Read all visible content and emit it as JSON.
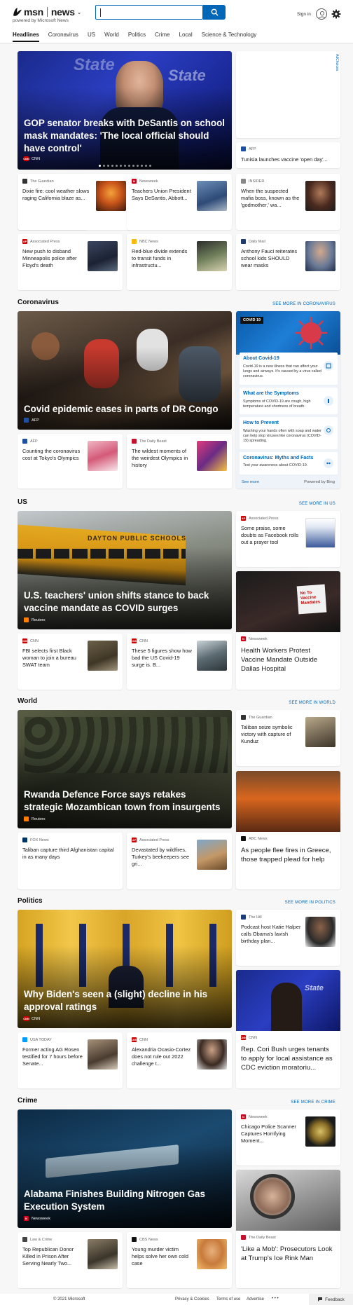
{
  "header": {
    "logo_msn": "msn",
    "logo_news": "news",
    "powered": "powered by Microsoft News",
    "search_value": "",
    "signin": "Sign in",
    "nav": [
      "Headlines",
      "Coronavirus",
      "US",
      "World",
      "Politics",
      "Crime",
      "Local",
      "Science & Technology"
    ]
  },
  "ad": {
    "label": "AdChoices"
  },
  "headlines": {
    "hero": {
      "title": "GOP senator breaks with DeSantis on school mask mandates: 'The local official should have control'",
      "source": "CNN",
      "slide_count": 13,
      "active_slide": 1
    },
    "side": {
      "source": "AFP",
      "title": "Tunisia launches vaccine 'open day'..."
    },
    "cards": [
      {
        "source": "The Guardian",
        "title": "Dixie fire: cool weather slows raging California blaze as..."
      },
      {
        "source": "Newsweek",
        "title": "Teachers Union President Says DeSantis, Abbott..."
      },
      {
        "source": "INSIDER",
        "title": "When the suspected mafia boss, known as the 'godmother,' wa..."
      },
      {
        "source": "Associated Press",
        "title": "New push to disband Minneapolis police after Floyd's death"
      },
      {
        "source": "NBC News",
        "title": "Red-blue divide extends to transit funds in infrastructu..."
      },
      {
        "source": "Daily Mail",
        "title": "Anthony Fauci reiterates school kids SHOULD wear masks"
      }
    ]
  },
  "coronavirus": {
    "heading": "Coronavirus",
    "see_more": "SEE MORE IN CORONAVIRUS",
    "hero": {
      "title": "Covid epidemic eases in parts of DR Congo",
      "source": "AFP"
    },
    "cards": [
      {
        "source": "AFP",
        "title": "Counting the coronavirus cost at Tokyo's Olympics"
      },
      {
        "source": "The Daily Beast",
        "title": "The wildest moments of the weirdest Olympics in history"
      }
    ],
    "info": {
      "badge": "COVID 19",
      "items": [
        {
          "title": "About Covid-19",
          "desc": "Covid-19 is a new illness that can affect your lungs and airways. It's caused by a virus called coronavirus."
        },
        {
          "title": "What are the Symptoms",
          "desc": "Symptoms of COVID-19 are cough, high temperature and shortness of breath."
        },
        {
          "title": "How to Prevent",
          "desc": "Washing your hands often with soap and water can help stop viruses like coronavirus (COVID-19) spreading."
        },
        {
          "title": "Coronavirus: Myths and Facts",
          "desc": "Test your awareness about COVID-19."
        }
      ],
      "see_more": "See more",
      "powered": "Powered by Bing"
    }
  },
  "us": {
    "heading": "US",
    "see_more": "SEE MORE IN US",
    "hero": {
      "title": "U.S. teachers' union shifts stance to back vaccine mandate as COVID surges",
      "source": "Reuters"
    },
    "side_top": {
      "source": "Associated Press",
      "title": "Some praise, some doubts as Facebook rolls out a prayer tool"
    },
    "side_big": {
      "source": "Newsweek",
      "title": "Health Workers Protest Vaccine Mandate Outside Dallas Hospital",
      "sign_text": "No To Vaccine Mandates"
    },
    "cards": [
      {
        "source": "CNN",
        "title": "FBI selects first Black woman to join a bureau SWAT team"
      },
      {
        "source": "CNN",
        "title": "These 5 figures show how bad the US Covid-19 surge is. B..."
      }
    ]
  },
  "world": {
    "heading": "World",
    "see_more": "SEE MORE IN WORLD",
    "hero": {
      "title": "Rwanda Defence Force says retakes strategic Mozambican town from insurgents",
      "source": "Reuters"
    },
    "side_top": {
      "source": "The Guardian",
      "title": "Taliban seize symbolic victory with capture of Kunduz"
    },
    "side_big": {
      "source": "ABC News",
      "title": "As people flee fires in Greece, those trapped plead for help"
    },
    "cards": [
      {
        "source": "FOX News",
        "title": "Taliban capture third Afghanistan capital in as many days"
      },
      {
        "source": "Associated Press",
        "title": "Devastated by wildfires, Turkey's beekeepers see gri..."
      }
    ]
  },
  "politics": {
    "heading": "Politics",
    "see_more": "SEE MORE IN POLITICS",
    "hero": {
      "title": "Why Biden's seen a (slight) decline in his approval ratings",
      "source": "CNN"
    },
    "side_top": {
      "source": "The Hill",
      "title": "Podcast host Katie Halper calls Obama's lavish birthday plan..."
    },
    "side_big": {
      "source": "CNN",
      "title": "Rep. Cori Bush urges tenants to apply for local assistance as CDC eviction moratoriu..."
    },
    "cards": [
      {
        "source": "USA TODAY",
        "title": "Former acting AG Rosen testified for 7 hours before Senate..."
      },
      {
        "source": "CNN",
        "title": "Alexandria Ocasio-Cortez does not rule out 2022 challenge t..."
      }
    ]
  },
  "crime": {
    "heading": "Crime",
    "see_more": "SEE MORE IN CRIME",
    "hero": {
      "title": "Alabama Finishes Building Nitrogen Gas Execution System",
      "source": "Newsweek"
    },
    "side_top": {
      "source": "Newsweek",
      "title": "Chicago Police Scanner Captures Horrifying Moment..."
    },
    "side_big": {
      "source": "The Daily Beast",
      "title": "'Like a Mob': Prosecutors Look at Trump's Ice Rink Man"
    },
    "cards": [
      {
        "source": "Law & Crime",
        "title": "Top Republican Donor Killed in Prison After Serving Nearly Two..."
      },
      {
        "source": "CBS News",
        "title": "Young murder victim helps solve her own cold case"
      }
    ]
  },
  "footer": {
    "copyright": "© 2021 Microsoft",
    "links": [
      "Privacy & Cookies",
      "Terms of use",
      "Advertise"
    ],
    "more": "• • •",
    "feedback": "Feedback"
  },
  "colors": {
    "accent": "#0067b8",
    "cnn": "#cc0000",
    "newsweek": "#d0021b"
  }
}
